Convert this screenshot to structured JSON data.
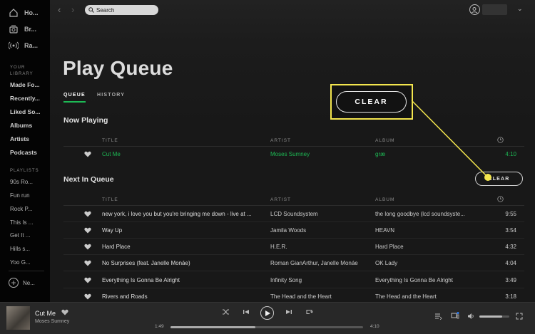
{
  "sidebar": {
    "nav": [
      {
        "label": "Ho...",
        "icon": "home-icon"
      },
      {
        "label": "Br...",
        "icon": "browse-icon"
      },
      {
        "label": "Ra...",
        "icon": "radio-icon"
      }
    ],
    "library_heading_1": "YOUR",
    "library_heading_2": "LIBRARY",
    "library": [
      "Made Fo...",
      "Recently...",
      "Liked So...",
      "Albums",
      "Artists",
      "Podcasts"
    ],
    "playlists_heading": "PLAYLISTS",
    "playlists": [
      "90s Ro...",
      "Fun run",
      "Rock P...",
      "This Is ...",
      "Get It ...",
      "Hills s...",
      "Yoo G..."
    ],
    "new_playlist": "Ne..."
  },
  "topbar": {
    "back": "‹",
    "forward": "›",
    "search_placeholder": "Search",
    "chevron": "⌄"
  },
  "page": {
    "title": "Play Queue",
    "tabs": [
      "QUEUE",
      "HISTORY"
    ],
    "now_playing_title": "Now Playing",
    "next_title": "Next In Queue",
    "clear_label": "CLEAR",
    "callout_clear_label": "CLEAR"
  },
  "columns": {
    "title": "TITLE",
    "artist": "ARTIST",
    "album": "ALBUM"
  },
  "now_playing": {
    "title": "Cut Me",
    "artist": "Moses Sumney",
    "album": "græ",
    "duration": "4:10"
  },
  "queue": [
    {
      "title": "new york, i love you but you're bringing me down - live at ...",
      "artist": "LCD Soundsystem",
      "album": "the long goodbye (lcd soundsyste...",
      "duration": "9:55"
    },
    {
      "title": "Way Up",
      "artist": "Jamila Woods",
      "album": "HEAVN",
      "duration": "3:54"
    },
    {
      "title": "Hard Place",
      "artist": "H.E.R.",
      "album": "Hard Place",
      "duration": "4:32"
    },
    {
      "title": "No Surprises (feat. Janelle Monáe)",
      "artist": "Roman GianArthur, Janelle Monáe",
      "album": "OK Lady",
      "duration": "4:04"
    },
    {
      "title": "Everything Is Gonna Be Alright",
      "artist": "Infinity Song",
      "album": "Everything Is Gonna Be Alright",
      "duration": "3:49"
    },
    {
      "title": "Rivers and Roads",
      "artist": "The Head and the Heart",
      "album": "The Head and the Heart",
      "duration": "3:18"
    }
  ],
  "player": {
    "title": "Cut Me",
    "artist": "Moses Sumney",
    "elapsed": "1:49",
    "total": "4:10",
    "progress_fraction": 0.44,
    "volume_fraction": 0.75
  },
  "colors": {
    "accent": "#1db954",
    "callout": "#f4e64e"
  }
}
